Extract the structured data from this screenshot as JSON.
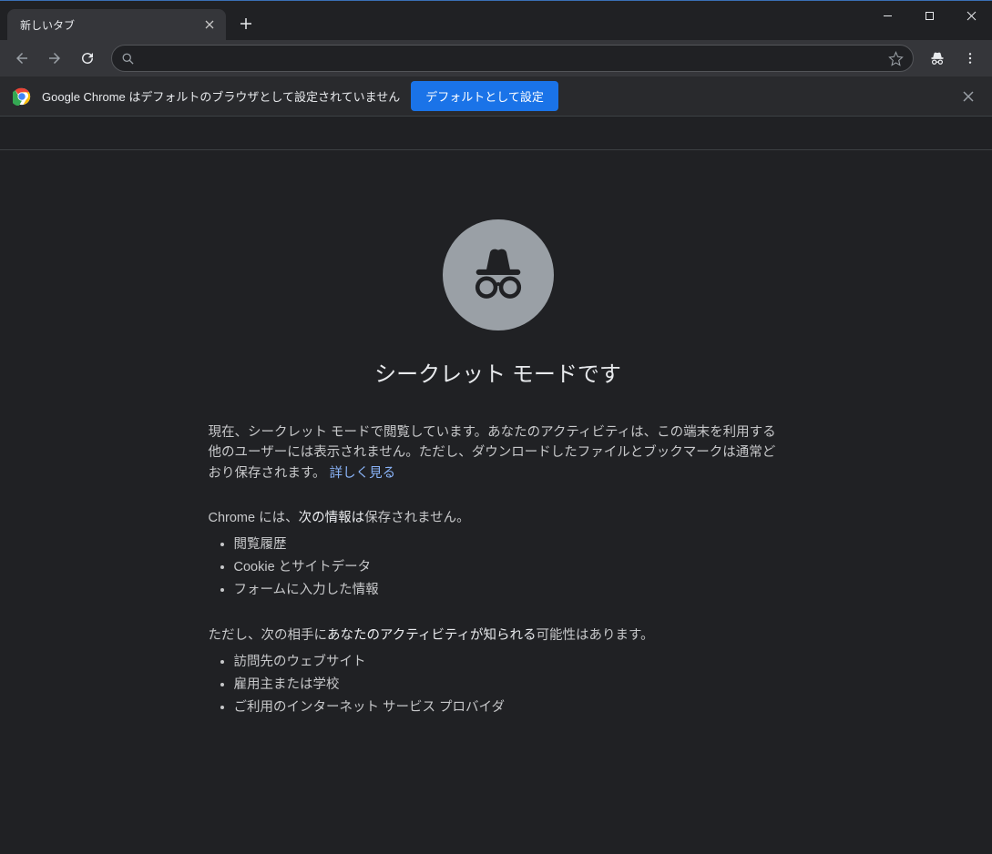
{
  "tab": {
    "title": "新しいタブ"
  },
  "infobar": {
    "text": "Google Chrome はデフォルトのブラウザとして設定されていません",
    "button": "デフォルトとして設定"
  },
  "incognito": {
    "heading": "シークレット モードです",
    "para_part1": "現在、シークレット モードで閲覧しています。あなたのアクティビティは、この端末を利用する他のユーザーには表示されません。ただし、ダウンロードしたファイルとブックマークは通常どおり保存されます。",
    "learn_more": "詳しく見る",
    "notsaved_pre": "Chrome には、",
    "notsaved_bold": "次の情報は",
    "notsaved_post": "保存されません。",
    "notsaved_items": [
      "閲覧履歴",
      "Cookie とサイトデータ",
      "フォームに入力した情報"
    ],
    "visible_pre": "ただし、次の相手に",
    "visible_bold": "あなたのアクティビティが知られる",
    "visible_post": "可能性はあります。",
    "visible_items": [
      "訪問先のウェブサイト",
      "雇用主または学校",
      "ご利用のインターネット サービス プロバイダ"
    ]
  }
}
